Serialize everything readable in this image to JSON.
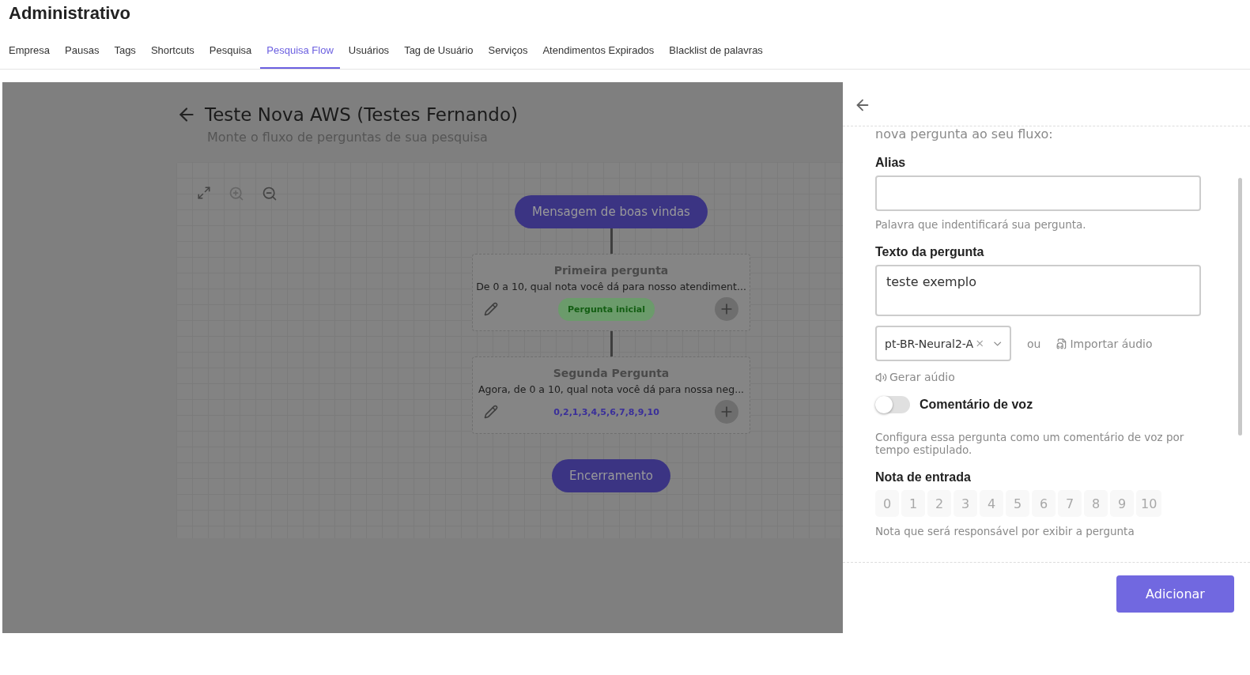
{
  "header": {
    "title": "Administrativo"
  },
  "tabs": [
    {
      "label": "Empresa",
      "selected": false
    },
    {
      "label": "Pausas",
      "selected": false
    },
    {
      "label": "Tags",
      "selected": false
    },
    {
      "label": "Shortcuts",
      "selected": false
    },
    {
      "label": "Pesquisa",
      "selected": false
    },
    {
      "label": "Pesquisa Flow",
      "selected": true
    },
    {
      "label": "Usuários",
      "selected": false
    },
    {
      "label": "Tag de Usuário",
      "selected": false
    },
    {
      "label": "Serviços",
      "selected": false
    },
    {
      "label": "Atendimentos Expirados",
      "selected": false
    },
    {
      "label": "Blacklist de palavras",
      "selected": false
    }
  ],
  "flow": {
    "title": "Teste Nova AWS (Testes Fernando)",
    "subtitle": "Monte o fluxo de perguntas de sua pesquisa",
    "start_node": "Mensagem de boas vindas",
    "questions": [
      {
        "title": "Primeira pergunta",
        "text": "De 0 a 10, qual nota você dá para nosso atendiment...",
        "kind": "initial",
        "badge": "Pergunta inicial"
      },
      {
        "title": "Segunda Pergunta",
        "text": "Agora, de 0 a 10, qual nota você dá para nossa neg...",
        "kind": "notes",
        "badge": "0,2,1,3,4,5,6,7,8,9,10"
      }
    ],
    "end_node": "Encerramento"
  },
  "drawer": {
    "intro": "nova pergunta ao seu fluxo:",
    "alias": {
      "label": "Alias",
      "hint": "Palavra que indentificará sua pergunta."
    },
    "question_text": {
      "label": "Texto da pergunta",
      "value": "teste exemplo"
    },
    "voice": {
      "value": "pt-BR-Neural2-A",
      "or": "ou",
      "import": "Importar áudio",
      "generate": "Gerar aúdio"
    },
    "voice_comment": {
      "label": "Comentário de voz",
      "on": false,
      "hint": "Configura essa pergunta como um comentário de voz por tempo estipulado."
    },
    "entry_note": {
      "label": "Nota de entrada",
      "hint": "Nota que será responsável por exibir a pergunta",
      "options": [
        {
          "label": "0",
          "selected": false
        },
        {
          "label": "1",
          "selected": false
        },
        {
          "label": "2",
          "selected": false
        },
        {
          "label": "3",
          "selected": false
        },
        {
          "label": "4",
          "selected": false
        },
        {
          "label": "5",
          "selected": false
        },
        {
          "label": "6",
          "selected": false
        },
        {
          "label": "7",
          "selected": false
        },
        {
          "label": "8",
          "selected": false
        },
        {
          "label": "9",
          "selected": false
        },
        {
          "label": "10",
          "selected": false
        }
      ]
    },
    "submit": "Adicionar"
  }
}
